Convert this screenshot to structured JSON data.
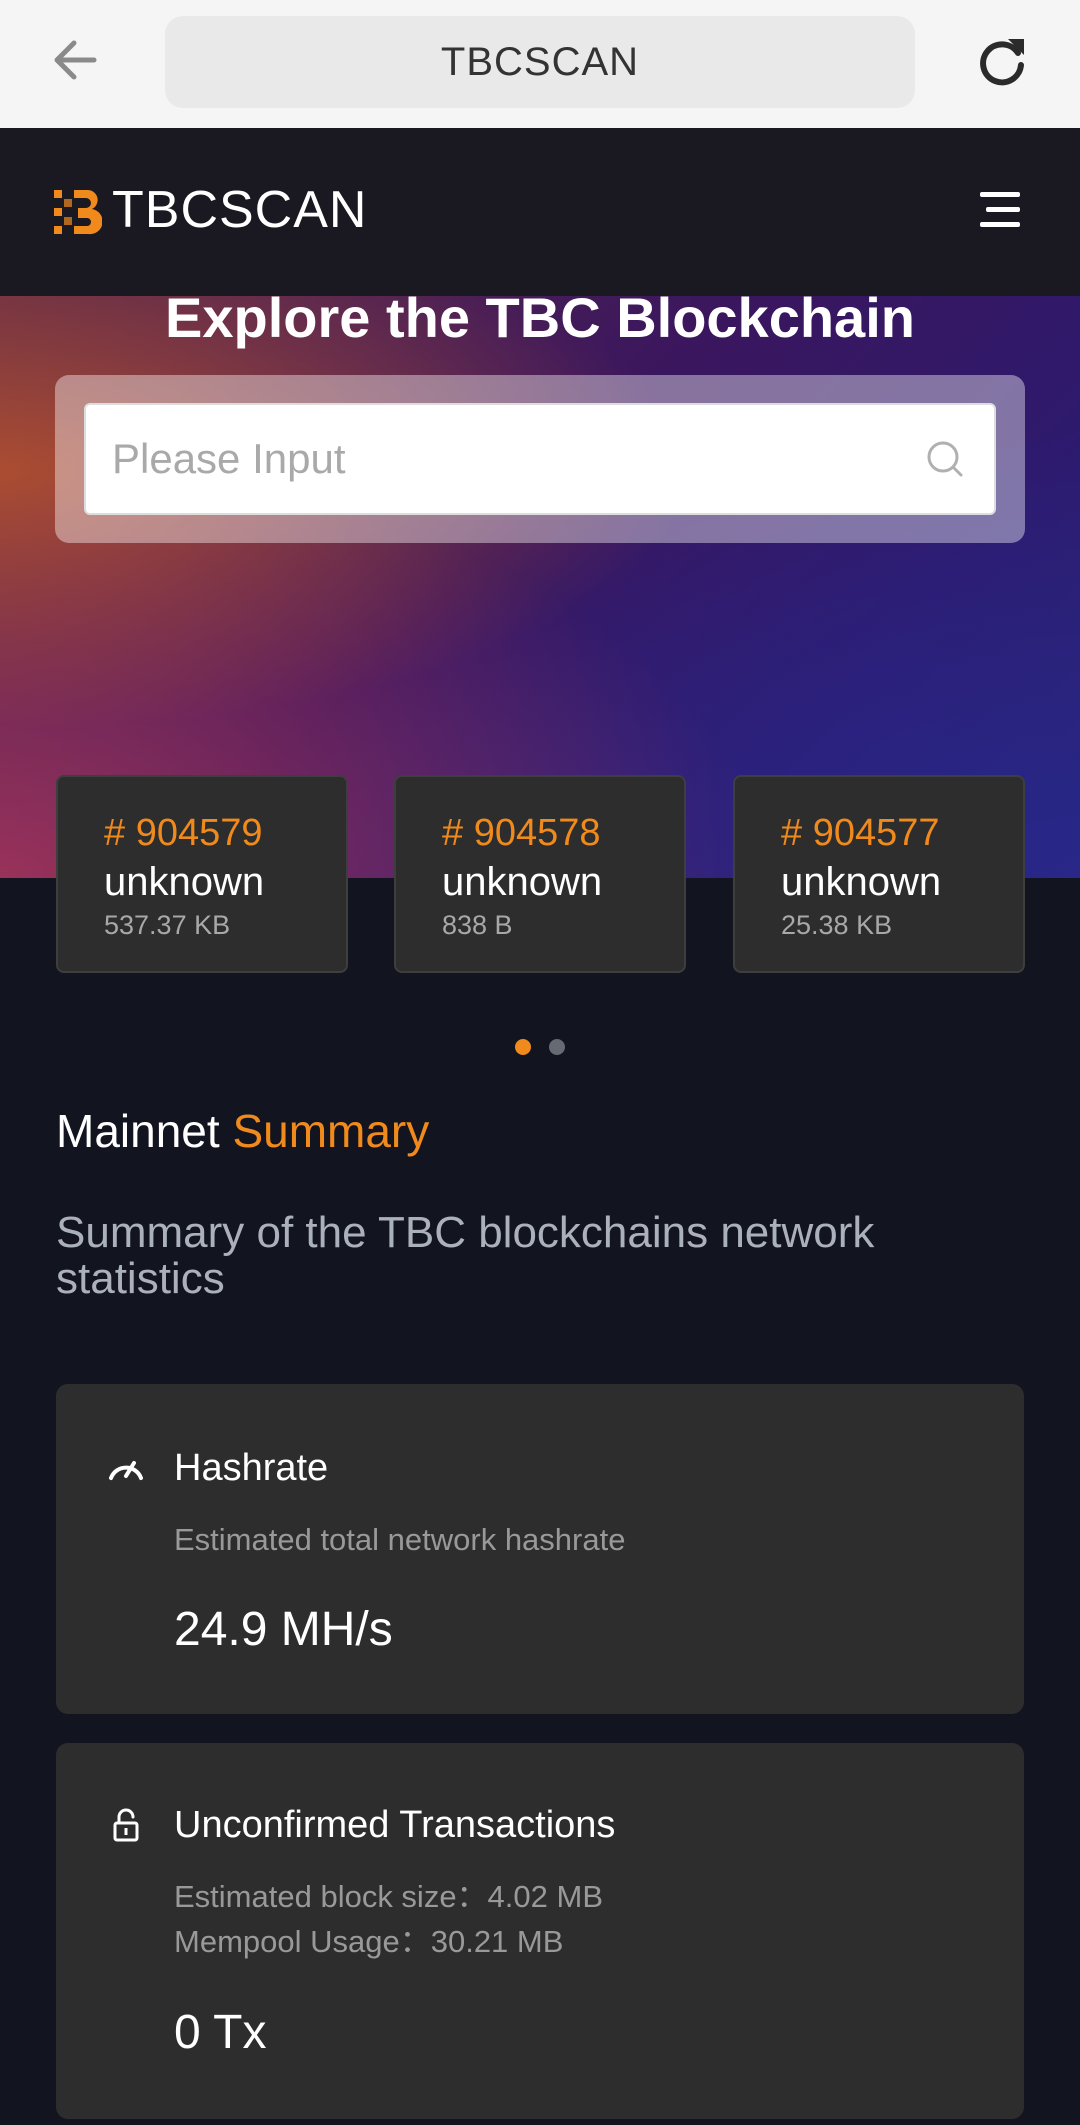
{
  "browser": {
    "url_title": "TBCSCAN"
  },
  "header": {
    "logo_text": "TBCSCAN",
    "brand_color": "#f08a1c"
  },
  "hero": {
    "title": "Explore the TBC Blockchain",
    "search_placeholder": "Please Input"
  },
  "blocks": [
    {
      "number": "# 904579",
      "miner": "unknown",
      "size": "537.37 KB"
    },
    {
      "number": "# 904578",
      "miner": "unknown",
      "size": "838 B"
    },
    {
      "number": "# 904577",
      "miner": "unknown",
      "size": "25.38 KB"
    }
  ],
  "carousel": {
    "pages": 2,
    "active": 1
  },
  "summary": {
    "title_main": "Mainnet",
    "title_accent": "Summary",
    "subtitle": "Summary of the TBC blockchains network statistics"
  },
  "hashrate": {
    "icon": "gauge-icon",
    "title": "Hashrate",
    "description": "Estimated total network hashrate",
    "value": "24.9 MH/s"
  },
  "unconfirmed": {
    "icon": "unlock-icon",
    "title": "Unconfirmed Transactions",
    "block_size": "Estimated block size：4.02 MB",
    "mempool": "Mempool Usage：30.21 MB",
    "value": "0 Tx"
  }
}
